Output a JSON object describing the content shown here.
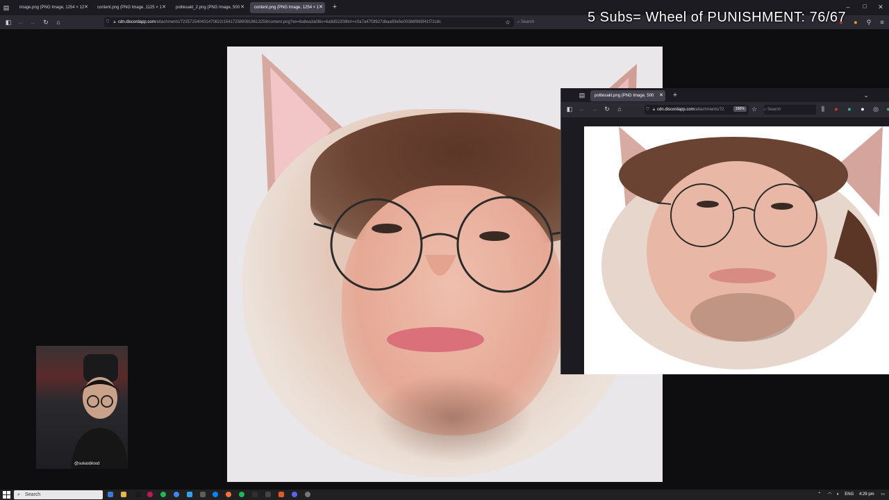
{
  "browser": {
    "tabs": [
      {
        "label": "image.png (PNG Image, 1254 × 12",
        "active": false
      },
      {
        "label": "content.png (PNG Image, 1125 × 1",
        "active": false
      },
      {
        "label": "politesakt_2.png (PNG Image, 500",
        "active": false
      },
      {
        "label": "content.png (PNG Image, 1254 × 1",
        "active": true
      }
    ],
    "new_tab": "+",
    "url_host": "cdn.discordapp.com",
    "url_path": "/attachments/723571540431470622/1541725890818613258/content.png?ex=6a8ea3a08is=6a8d52208hm=c0a7a47f3f627dbaa93e5e00386f985f41f72c8c",
    "search_placeholder": "Search"
  },
  "overlay": {
    "title": "5 Subs= Wheel of PUNISHMENT: 76/67"
  },
  "popup": {
    "tab_label": "politesakt.png (PNG Image, 500",
    "new_tab": "+",
    "url_host": "cdn.discordapp.com",
    "url_path": "/attachments/72",
    "zoom": "190%",
    "search_placeholder": "Search"
  },
  "webcam": {
    "handle": "@sukasblood"
  },
  "taskbar": {
    "search_label": "Search",
    "language": "ENG",
    "time": "4:29 pm"
  },
  "colors": {
    "accent": "#42414d",
    "background": "#0e0e10"
  }
}
